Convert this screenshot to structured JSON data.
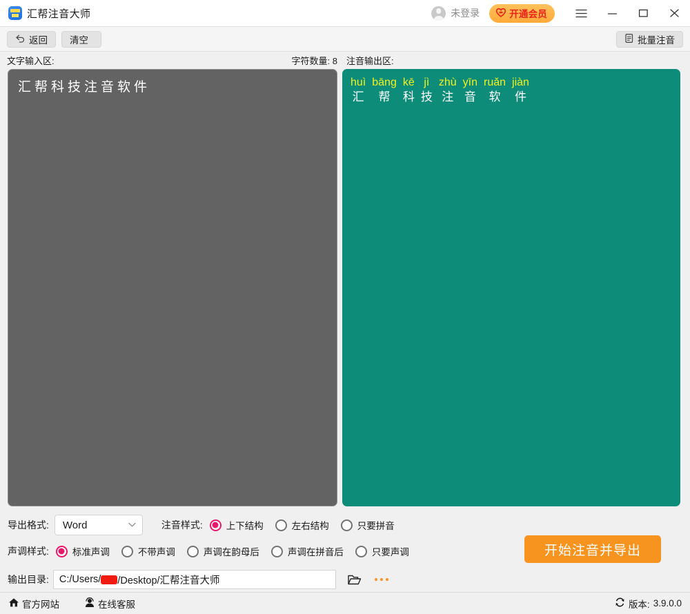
{
  "titlebar": {
    "app_title": "汇帮注音大师",
    "app_icon": "app-logo-icon",
    "account_label": "未登录",
    "vip_label": "开通会员",
    "menu_icon": "hamburger-menu-icon",
    "minimize_icon": "minimize-icon",
    "maximize_icon": "maximize-icon",
    "close_icon": "close-icon"
  },
  "toolbar": {
    "back_label": "返回",
    "back_icon": "back-arrow-icon",
    "clear_label": "清空",
    "batch_label": "批量注音",
    "batch_icon": "document-icon"
  },
  "panels": {
    "input_label": "文字输入区:",
    "char_count_label": "字符数量:",
    "char_count_value": "8",
    "input_text": "汇帮科技注音软件",
    "output_label": "注音输出区:",
    "output_items": [
      {
        "pinyin": "huì",
        "hanzi": "汇"
      },
      {
        "pinyin": "bāng",
        "hanzi": "帮"
      },
      {
        "pinyin": "kē",
        "hanzi": "科"
      },
      {
        "pinyin": "jì",
        "hanzi": "技"
      },
      {
        "pinyin": "zhù",
        "hanzi": "注"
      },
      {
        "pinyin": "yīn",
        "hanzi": "音"
      },
      {
        "pinyin": "ruǎn",
        "hanzi": "软"
      },
      {
        "pinyin": "jiàn",
        "hanzi": "件"
      }
    ]
  },
  "options": {
    "export_format_label": "导出格式:",
    "export_format_value": "Word",
    "annotation_style_label": "注音样式:",
    "annotation_styles": [
      {
        "label": "上下结构",
        "selected": true
      },
      {
        "label": "左右结构",
        "selected": false
      },
      {
        "label": "只要拼音",
        "selected": false
      }
    ],
    "tone_style_label": "声调样式:",
    "tone_styles": [
      {
        "label": "标准声调",
        "selected": true
      },
      {
        "label": "不带声调",
        "selected": false
      },
      {
        "label": "声调在韵母后",
        "selected": false
      },
      {
        "label": "声调在拼音后",
        "selected": false
      },
      {
        "label": "只要声调",
        "selected": false
      }
    ],
    "export_button_label": "开始注音并导出"
  },
  "output_dir": {
    "label": "输出目录:",
    "path_prefix": "C:/Users/",
    "path_suffix": "/Desktop/汇帮注音大师",
    "folder_icon": "folder-open-icon",
    "more_icon": "ellipsis-icon"
  },
  "statusbar": {
    "website_label": "官方网站",
    "website_icon": "home-icon",
    "support_label": "在线客服",
    "support_icon": "headset-person-icon",
    "version_label": "版本:",
    "version_value": "3.9.0.0",
    "version_icon": "refresh-icon"
  },
  "colors": {
    "vip_orange": "#ffa93a",
    "vip_red_text": "#e8221a",
    "input_bg": "#636363",
    "output_bg": "#0e8c7a",
    "pinyin_yellow": "#f2f21f",
    "radio_pink": "#e8186b",
    "export_orange": "#f79420",
    "redaction_red": "#f21b12"
  }
}
